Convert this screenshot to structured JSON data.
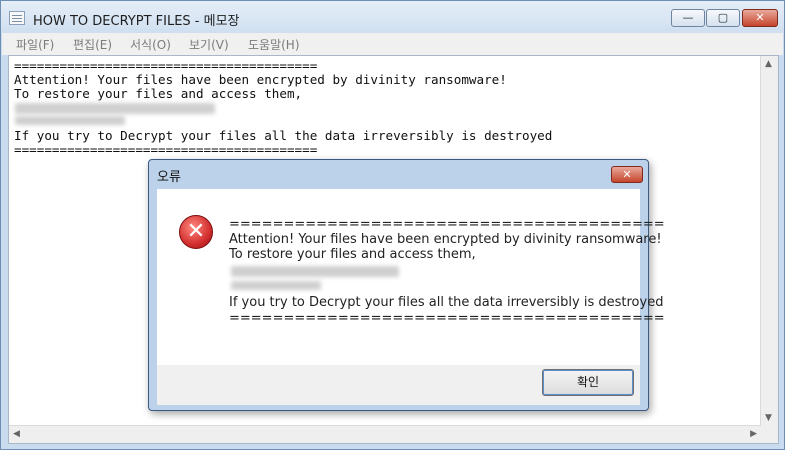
{
  "window": {
    "title": "HOW TO DECRYPT FILES - 메모장",
    "controls": {
      "minimize": "—",
      "maximize": "▢",
      "close": "✕"
    }
  },
  "menu": [
    "파일(F)",
    "편집(E)",
    "서식(O)",
    "보기(V)",
    "도움말(H)"
  ],
  "note": {
    "line1": "========================================",
    "line2": "Attention! Your files have been encrypted by divinity ransomware!",
    "line3": "To restore your files and access them,",
    "line4": "If you try to Decrypt your files all the data irreversibly is destroyed",
    "line5": "========================================"
  },
  "dialog": {
    "title": "오류",
    "close": "✕",
    "icon": "error-icon",
    "line1": "========================================",
    "line2": "Attention! Your files have been encrypted by divinity ransomware!",
    "line3": "To restore your files and access them,",
    "line4": "If you try to Decrypt your files all the data irreversibly is destroyed",
    "line5": "========================================",
    "ok_button": "확인"
  }
}
